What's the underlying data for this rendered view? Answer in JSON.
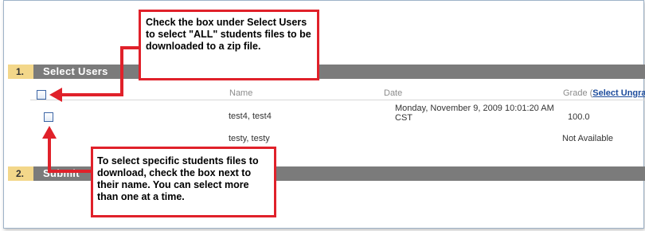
{
  "sections": [
    {
      "number": "1.",
      "label": "Select Users"
    },
    {
      "number": "2.",
      "label": "Submit"
    }
  ],
  "table": {
    "columns": {
      "name": "Name",
      "date": "Date",
      "grade_prefix": "Grade (",
      "grade_link": "Select Ungrad"
    },
    "rows": [
      {
        "name": "test4, test4",
        "date": "Monday, November 9, 2009 10:01:20 AM CST",
        "grade": "100.0"
      },
      {
        "name": "testy, testy",
        "date": "",
        "grade": "Not Available"
      }
    ]
  },
  "callouts": {
    "select_all": "Check the box under Select Users to select \"ALL\" students files to be downloaded to a zip file.",
    "select_specific": "To select specific students files to download, check the box next to their name.  You can select more than one at a time."
  },
  "colors": {
    "callout_border": "#e0212a",
    "section_bar": "#7b7b7b",
    "section_number": "#f3d78a",
    "link": "#1c4b9c"
  }
}
